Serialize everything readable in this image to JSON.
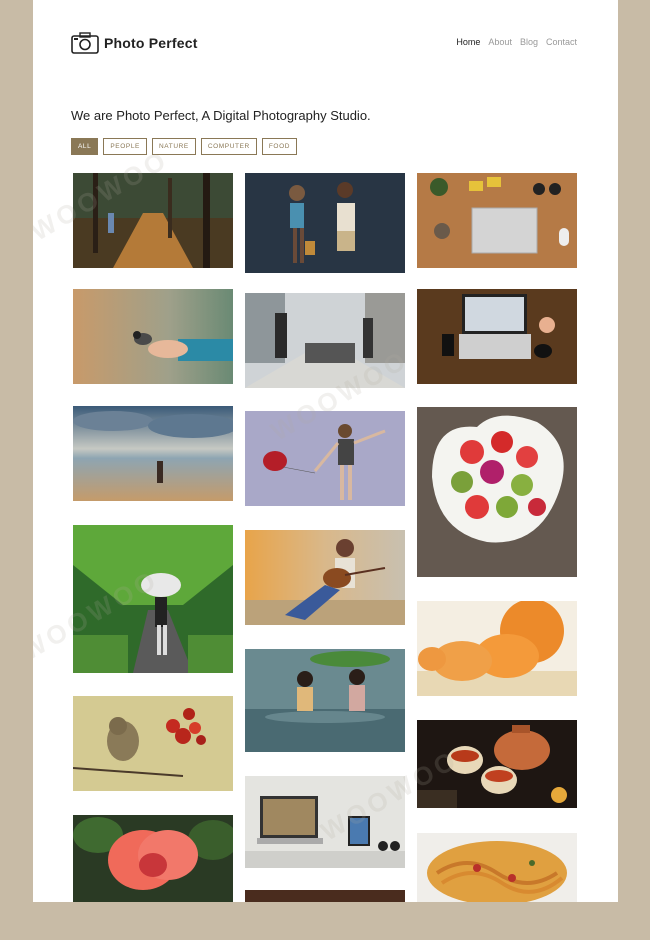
{
  "brand": {
    "name": "Photo Perfect",
    "icon": "camera-icon"
  },
  "nav": {
    "items": [
      {
        "label": "Home",
        "active": true
      },
      {
        "label": "About",
        "active": false
      },
      {
        "label": "Blog",
        "active": false
      },
      {
        "label": "Contact",
        "active": false
      }
    ]
  },
  "headline": "We are Photo Perfect, A Digital Photography Studio.",
  "filters": [
    {
      "label": "ALL",
      "active": true
    },
    {
      "label": "PEOPLE",
      "active": false
    },
    {
      "label": "NATURE",
      "active": false
    },
    {
      "label": "COMPUTER",
      "active": false
    },
    {
      "label": "FOOD",
      "active": false
    }
  ],
  "colors": {
    "accent": "#8a7856",
    "outer_background": "#c8bba6",
    "page_background": "#ffffff"
  },
  "gallery": {
    "columns": [
      [
        {
          "subject": "autumn-forest-path-child"
        },
        {
          "subject": "bird-on-hand"
        },
        {
          "subject": "sunset-beach-person"
        },
        {
          "subject": "woman-umbrella-green-tunnel"
        },
        {
          "subject": "bird-and-red-berries"
        },
        {
          "subject": "pink-hibiscus-flower"
        }
      ],
      [
        {
          "subject": "two-children-with-bag"
        },
        {
          "subject": "city-street-crowd"
        },
        {
          "subject": "girl-with-red-balloon"
        },
        {
          "subject": "girl-playing-guitar"
        },
        {
          "subject": "two-girls-in-rain-with-leaf"
        },
        {
          "subject": "laptop-and-tablet-on-desk"
        },
        {
          "subject": "dark-photo"
        }
      ],
      [
        {
          "subject": "laptop-on-wooden-desk"
        },
        {
          "subject": "laptop-phone-on-wood"
        },
        {
          "subject": "fruit-bowl-heart"
        },
        {
          "subject": "peeled-oranges"
        },
        {
          "subject": "tea-pot-and-cups"
        },
        {
          "subject": "pasta-dish"
        }
      ]
    ]
  }
}
